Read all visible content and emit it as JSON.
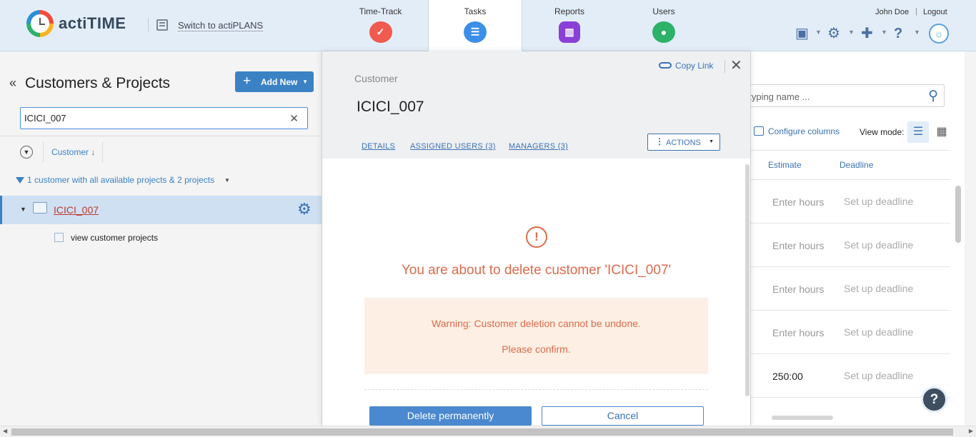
{
  "header": {
    "brand": "actiTIME",
    "switch_link": "Switch to actiPLANS",
    "nav": [
      {
        "label": "Time-Track",
        "color": "#f05a4f",
        "icon": "check-icon"
      },
      {
        "label": "Tasks",
        "color": "#3b8fe8",
        "icon": "list-icon"
      },
      {
        "label": "Reports",
        "color": "#8a3fd6",
        "icon": "bar-chart-icon"
      },
      {
        "label": "Users",
        "color": "#2db26a",
        "icon": "user-icon"
      }
    ],
    "user_name": "John Doe",
    "separator": "|",
    "logout": "Logout"
  },
  "left_panel": {
    "title": "Customers & Projects",
    "add_new": "Add New",
    "search_value": "ICICI_007",
    "sort_column": "Customer",
    "filter_text": "1 customer with all available projects & 2 projects",
    "tree": {
      "customer_name": "ICICI_007",
      "sub_item": "view customer projects"
    }
  },
  "modal": {
    "copy_link": "Copy Link",
    "entity_type": "Customer",
    "entity_name": "ICICI_007",
    "tabs": [
      "DETAILS",
      "ASSIGNED USERS (3)",
      "MANAGERS (3)"
    ],
    "actions": "ACTIONS",
    "warning_title": "You are about to delete customer 'ICICI_007'",
    "warning_line1": "Warning: Customer deletion cannot be undone.",
    "warning_line2": "Please confirm.",
    "delete_button": "Delete permanently",
    "cancel_button": "Cancel"
  },
  "right_panel": {
    "search_placeholder": "t typing name ...",
    "configure_columns": "Configure columns",
    "view_mode_label": "View mode:",
    "columns": [
      "Estimate",
      "Deadline"
    ],
    "rows": [
      {
        "estimate": "Enter hours",
        "deadline": "Set up deadline"
      },
      {
        "estimate": "Enter hours",
        "deadline": "Set up deadline"
      },
      {
        "estimate": "Enter hours",
        "deadline": "Set up deadline"
      },
      {
        "estimate": "Enter hours",
        "deadline": "Set up deadline"
      },
      {
        "estimate": "250:00",
        "deadline": "Set up deadline"
      }
    ],
    "help": "?"
  }
}
